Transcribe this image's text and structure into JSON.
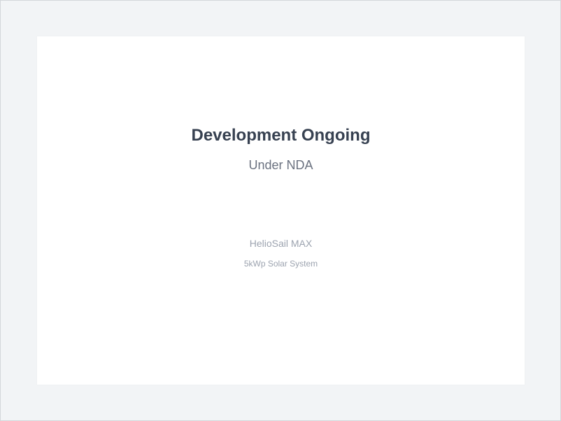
{
  "card": {
    "title": "Development Ongoing",
    "subtitle": "Under NDA"
  },
  "product": {
    "name": "HelioSail MAX",
    "description": "5kWp Solar System"
  },
  "colors": {
    "background": "#f2f4f6",
    "card": "#ffffff",
    "title": "#374151",
    "subtitle": "#6b7280",
    "muted": "#9ca3af"
  }
}
